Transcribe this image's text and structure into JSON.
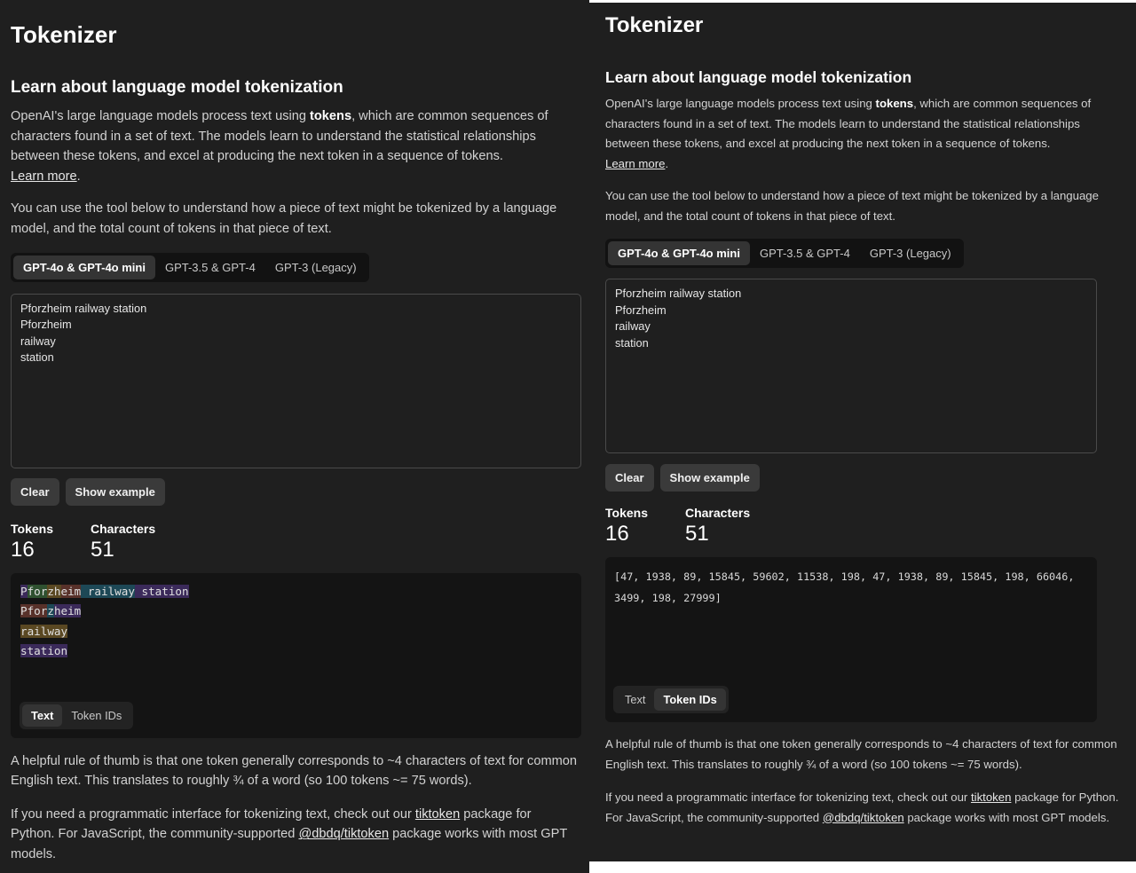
{
  "page": {
    "title": "Tokenizer",
    "subtitle": "Learn about language model tokenization",
    "intro_prefix": "OpenAI's large language models process text using ",
    "intro_bold": "tokens",
    "intro_suffix": ", which are common sequences of characters found in a set of text. The models learn to understand the statistical relationships between these tokens, and excel at producing the next token in a sequence of tokens.",
    "learn_more": "Learn more",
    "learn_more_punct": ".",
    "tool_text": "You can use the tool below to understand how a piece of text might be tokenized by a language model, and the total count of tokens in that piece of text.",
    "model_tabs": [
      "GPT-4o & GPT-4o mini",
      "GPT-3.5 & GPT-4",
      "GPT-3 (Legacy)"
    ],
    "active_model_tab": 0,
    "input_lines": [
      "Pforzheim railway station",
      "Pforzheim",
      "railway",
      "station"
    ],
    "buttons": {
      "clear": "Clear",
      "show_example": "Show example"
    },
    "stats": {
      "tokens_label": "Tokens",
      "tokens_value": "16",
      "characters_label": "Characters",
      "characters_value": "51"
    },
    "view_tabs": {
      "text": "Text",
      "token_ids": "Token IDs"
    },
    "rule_text": "A helpful rule of thumb is that one token generally corresponds to ~4 characters of text for common English text. This translates to roughly ¾ of a word (so 100 tokens ~= 75 words).",
    "api_prefix": "If you need a programmatic interface for tokenizing text, check out our ",
    "api_link1": "tiktoken",
    "api_middle": " package for Python. For JavaScript, the community-supported ",
    "api_link2": "@dbdq/tiktoken",
    "api_suffix": " package works with most GPT models."
  },
  "left_view": {
    "active_view": "text",
    "token_lines": [
      [
        {
          "t": "P",
          "c": 0
        },
        {
          "t": "for",
          "c": 1
        },
        {
          "t": "zh",
          "c": 2
        },
        {
          "t": "eim",
          "c": 3
        },
        {
          "t": " railway",
          "c": 4
        },
        {
          "t": " station",
          "c": 0
        }
      ],
      [
        {
          "t": "Pfor",
          "c": 3
        },
        {
          "t": "z",
          "c": 4
        },
        {
          "t": "heim",
          "c": 0
        }
      ],
      [
        {
          "t": "railway",
          "c": 2
        }
      ],
      [
        {
          "t": "station",
          "c": 0
        }
      ]
    ]
  },
  "right_view": {
    "active_view": "token_ids",
    "token_ids_text": "[47, 1938, 89, 15845, 59602, 11538, 198, 47, 1938, 89, 15845, 198, 66046, 3499, 198, 27999]"
  },
  "colors": {
    "background": "#1f1f1f",
    "token_palette": [
      "#3b2a5a",
      "#2f5130",
      "#5a4822",
      "#58312a",
      "#1d4856"
    ]
  }
}
